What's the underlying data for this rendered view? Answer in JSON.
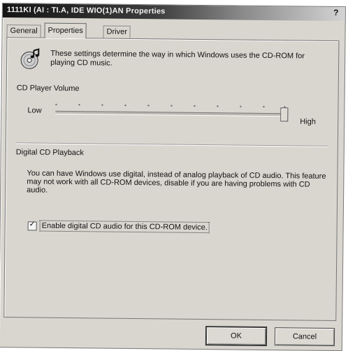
{
  "window": {
    "title": "1111KI (AI : TI.A, IDE WIO(1)AN Properties",
    "help_glyph": "?",
    "tabs": [
      {
        "label": "General",
        "active": false
      },
      {
        "label": "Properties",
        "active": true
      },
      {
        "label": "Driver",
        "active": false
      }
    ]
  },
  "properties": {
    "icon": "cd-audio-icon",
    "intro_text": "These settings determine the way in which Windows uses the CD-ROM for playing CD music.",
    "volume": {
      "group_label": "CD Player Volume",
      "low_label": "Low",
      "high_label": "High",
      "level_fraction": 0.99
    },
    "digital": {
      "group_label": "Digital CD Playback",
      "description": "You can have Windows use digital, instead of analog playback of CD audio. This feature may not work with all CD-ROM devices, disable if you are having problems with CD audio.",
      "checkbox_label": "Enable digital CD audio for this CD-ROM device.",
      "checked": true,
      "check_glyph": "✓"
    }
  },
  "buttons": {
    "ok_label": "OK",
    "cancel_label": "Cancel"
  }
}
